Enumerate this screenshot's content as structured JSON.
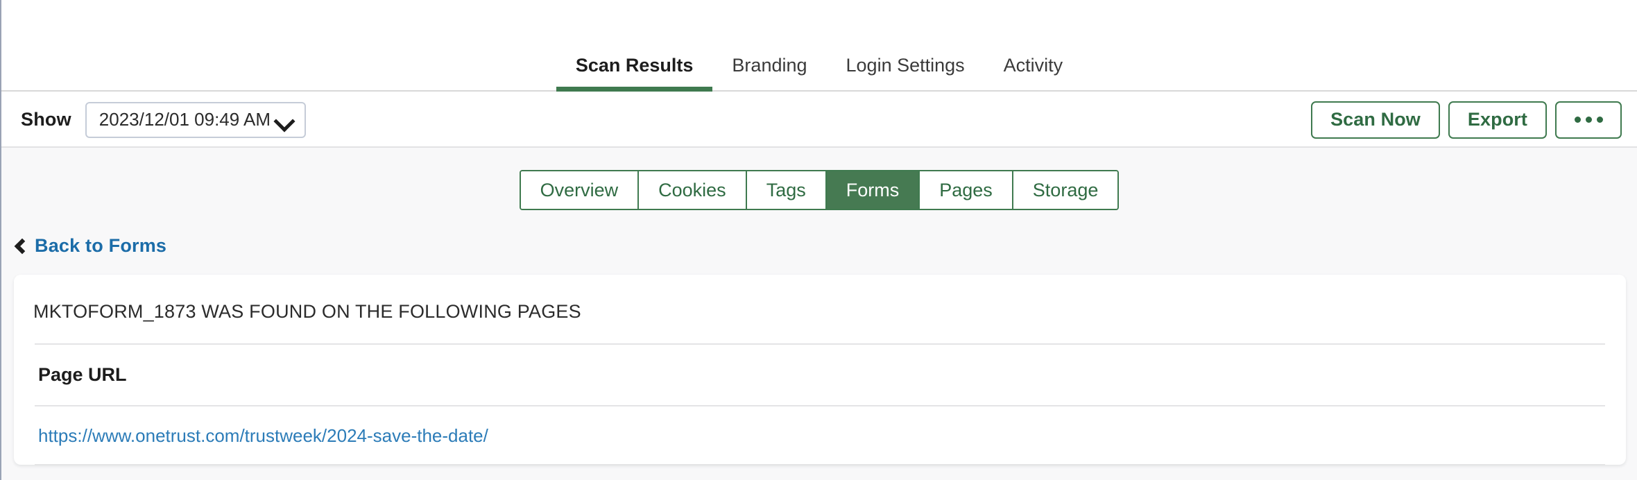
{
  "top_tabs": [
    {
      "label": "Scan Results",
      "active": true
    },
    {
      "label": "Branding",
      "active": false
    },
    {
      "label": "Login Settings",
      "active": false
    },
    {
      "label": "Activity",
      "active": false
    }
  ],
  "toolbar": {
    "show_label": "Show",
    "scan_select_value": "2023/12/01 09:49 AM",
    "chevron_icon": "chevron-down-icon",
    "scan_now_label": "Scan Now",
    "export_label": "Export",
    "more_label": "•••"
  },
  "segmented": [
    {
      "label": "Overview",
      "active": false
    },
    {
      "label": "Cookies",
      "active": false
    },
    {
      "label": "Tags",
      "active": false
    },
    {
      "label": "Forms",
      "active": true
    },
    {
      "label": "Pages",
      "active": false
    },
    {
      "label": "Storage",
      "active": false
    }
  ],
  "back_link": {
    "label": "Back to Forms",
    "icon": "chevron-left-icon"
  },
  "card": {
    "title": "MKTOFORM_1873 WAS FOUND ON THE FOLLOWING PAGES",
    "columns": [
      "Page URL"
    ],
    "rows": [
      {
        "page_url": "https://www.onetrust.com/trustweek/2024-save-the-date/"
      }
    ]
  },
  "colors": {
    "accent_green": "#3f7a4f",
    "active_green": "#467a52",
    "link_blue": "#2c7cb8",
    "back_link_blue": "#1b6ca8",
    "page_bg": "#f8f8f9",
    "card_bg": "#ffffff",
    "divider": "#e4e4e6"
  }
}
